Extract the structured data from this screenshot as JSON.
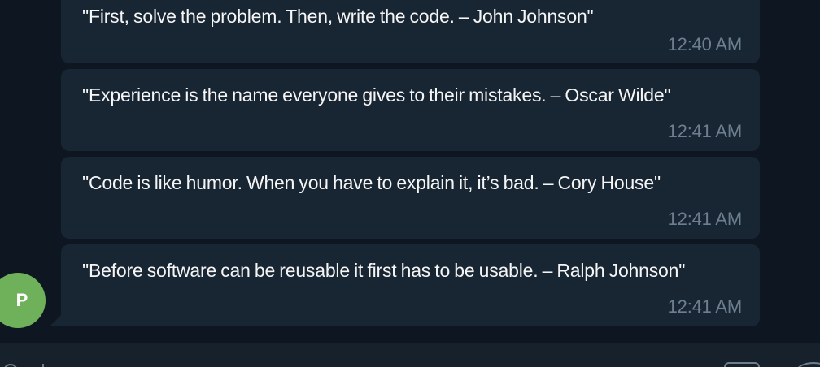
{
  "messages": [
    {
      "text": "\"First, solve the problem. Then, write the code. – John Johnson\"",
      "time": "12:40 AM"
    },
    {
      "text": "\"Experience is the name everyone gives to their mistakes. – Oscar Wilde\"",
      "time": "12:41 AM"
    },
    {
      "text": "\"Code is like humor. When you have to explain it, it’s bad. – Cory House\"",
      "time": "12:41 AM"
    },
    {
      "text": "\"Before software can be reusable it first has to be usable. – Ralph Johnson\"",
      "time": "12:41 AM"
    }
  ],
  "sender": {
    "initial": "P",
    "avatar_color": "#6fb15a"
  },
  "colors": {
    "background": "#0e1621",
    "bubble": "#182533",
    "timestamp": "#6d7f8f",
    "composer": "#17212b"
  },
  "composer": {
    "icons": [
      "attach-icon",
      "bot-command-icon",
      "emoji-icon"
    ]
  }
}
